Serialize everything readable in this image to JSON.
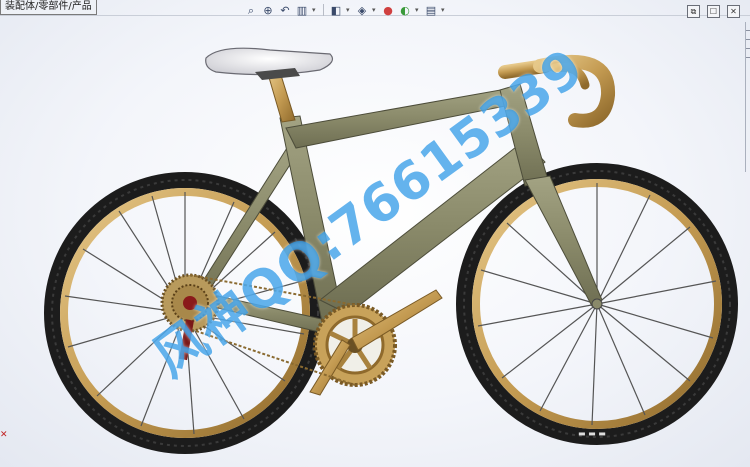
{
  "tab_label": "装配体/零部件/产品",
  "hud_icons": [
    "zoom-fit-icon",
    "zoom-area-icon",
    "previous-view-icon",
    "section-view-icon",
    "view-orientation-icon",
    "display-style-icon",
    "hide-show-icon",
    "edit-appearance-icon",
    "apply-scene-icon",
    "view-settings-icon"
  ],
  "window_controls": {
    "restore": "⧉",
    "maximize": "☐",
    "close": "✕"
  },
  "watermark_text": "风神QQ:76615339",
  "colors": {
    "frame": "#8e8e6e",
    "gold": "#c8a25a",
    "tire": "#1c1c1c",
    "saddle": "#e8e8ec",
    "watermark": "#2b8fe0"
  }
}
